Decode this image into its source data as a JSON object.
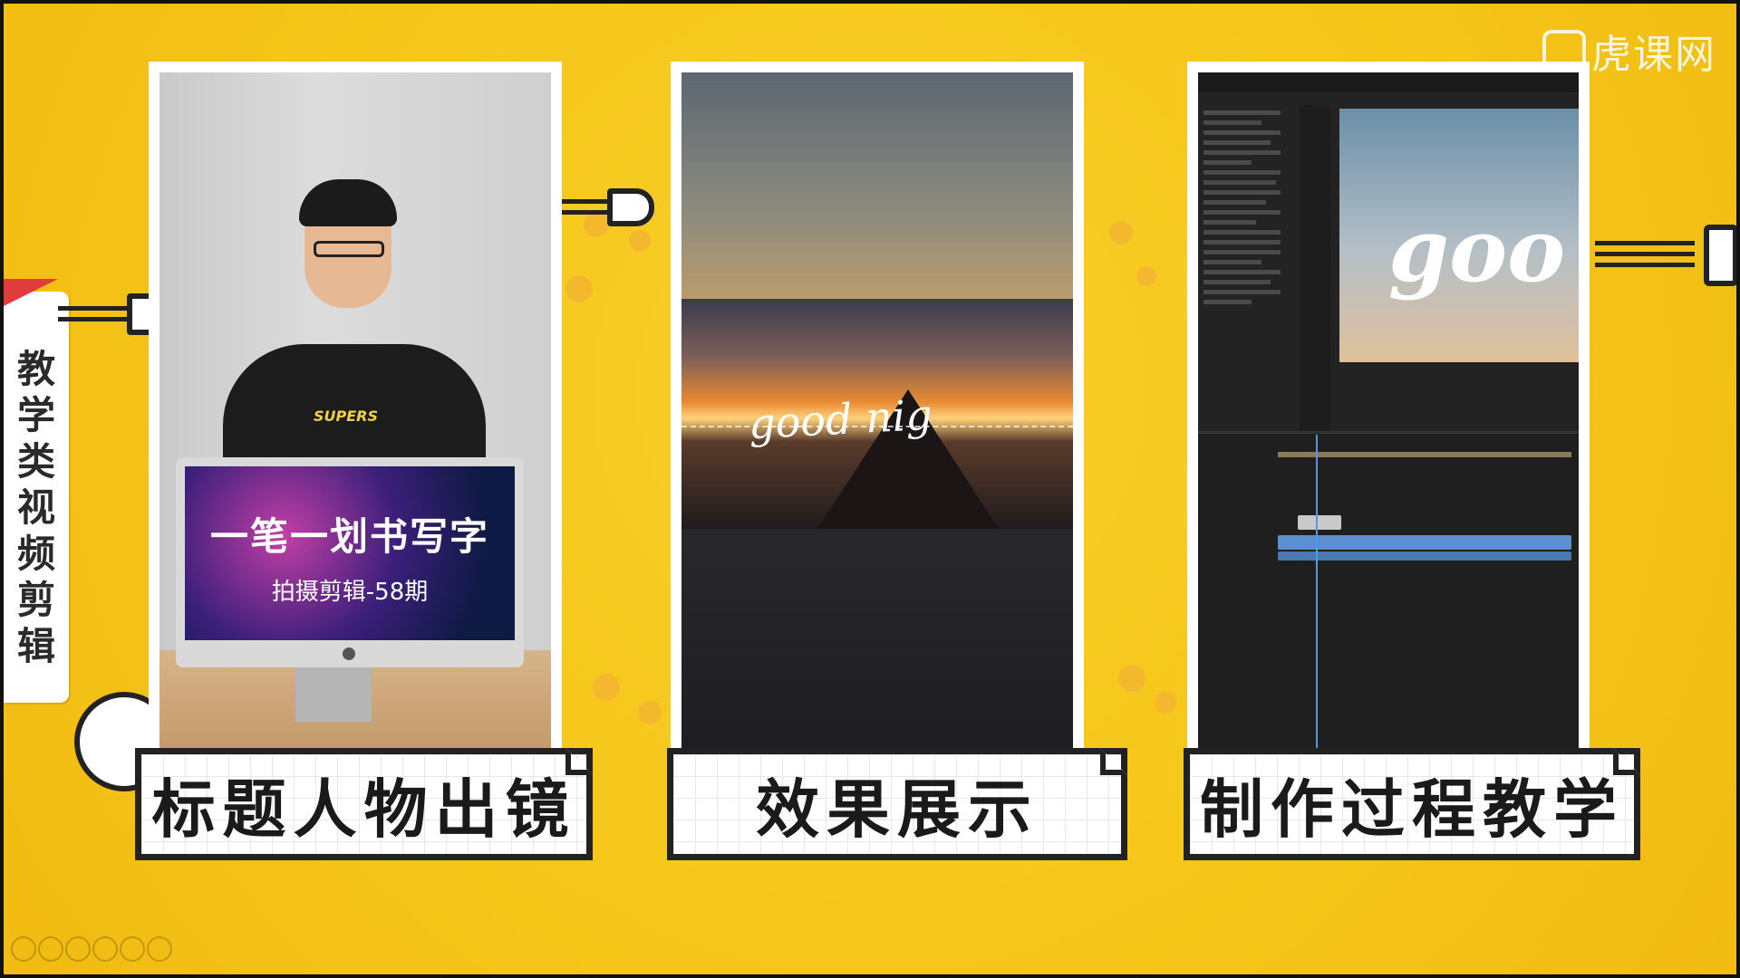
{
  "watermark": "虎课网",
  "side_tab": {
    "chars": [
      "教",
      "学",
      "类",
      "视",
      "频",
      "剪",
      "辑"
    ]
  },
  "panels": [
    {
      "label": "标题人物出镜",
      "monitor_title": "一笔一划书写字",
      "monitor_subtitle": "拍摄剪辑-58期",
      "shirt_text": "SUPERS"
    },
    {
      "label": "效果展示",
      "overlay_text": "good nig"
    },
    {
      "label": "制作过程教学",
      "preview_text": "goo"
    }
  ],
  "colors": {
    "background": "#f5c518",
    "accent_red": "#e23b3b",
    "outline": "#222222"
  }
}
